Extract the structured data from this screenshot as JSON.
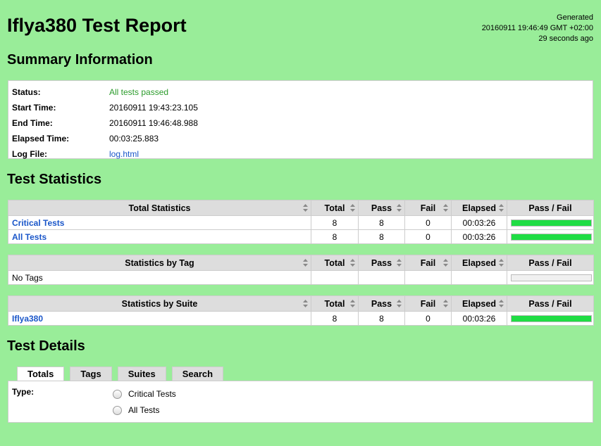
{
  "header": {
    "title": "Iflya380 Test Report",
    "generated_label": "Generated",
    "generated_time": "20160911 19:46:49 GMT +02:00",
    "generated_ago": "29 seconds ago"
  },
  "summary": {
    "heading": "Summary Information",
    "status_label": "Status:",
    "status_value": "All tests passed",
    "start_label": "Start Time:",
    "start_value": "20160911 19:43:23.105",
    "end_label": "End Time:",
    "end_value": "20160911 19:46:48.988",
    "elapsed_label": "Elapsed Time:",
    "elapsed_value": "00:03:25.883",
    "log_label": "Log File:",
    "log_value": "log.html"
  },
  "statistics": {
    "heading": "Test Statistics",
    "columns": [
      "Total",
      "Pass",
      "Fail",
      "Elapsed",
      "Pass / Fail"
    ],
    "total": {
      "header": "Total Statistics",
      "rows": [
        {
          "name": "Critical Tests",
          "total": "8",
          "pass": "8",
          "fail": "0",
          "elapsed": "00:03:26",
          "pass_ratio": 1.0
        },
        {
          "name": "All Tests",
          "total": "8",
          "pass": "8",
          "fail": "0",
          "elapsed": "00:03:26",
          "pass_ratio": 1.0
        }
      ]
    },
    "tag": {
      "header": "Statistics by Tag",
      "empty_text": "No Tags",
      "pass_ratio": 0
    },
    "suite": {
      "header": "Statistics by Suite",
      "rows": [
        {
          "name": "Iflya380",
          "total": "8",
          "pass": "8",
          "fail": "0",
          "elapsed": "00:03:26",
          "pass_ratio": 1.0
        }
      ]
    }
  },
  "details": {
    "heading": "Test Details",
    "tabs": [
      "Totals",
      "Tags",
      "Suites",
      "Search"
    ],
    "type_label": "Type:",
    "options": [
      "Critical Tests",
      "All Tests"
    ]
  },
  "colors": {
    "background": "#99ed99",
    "pass_green": "#1fdd44",
    "link_blue": "#1a56c9"
  }
}
